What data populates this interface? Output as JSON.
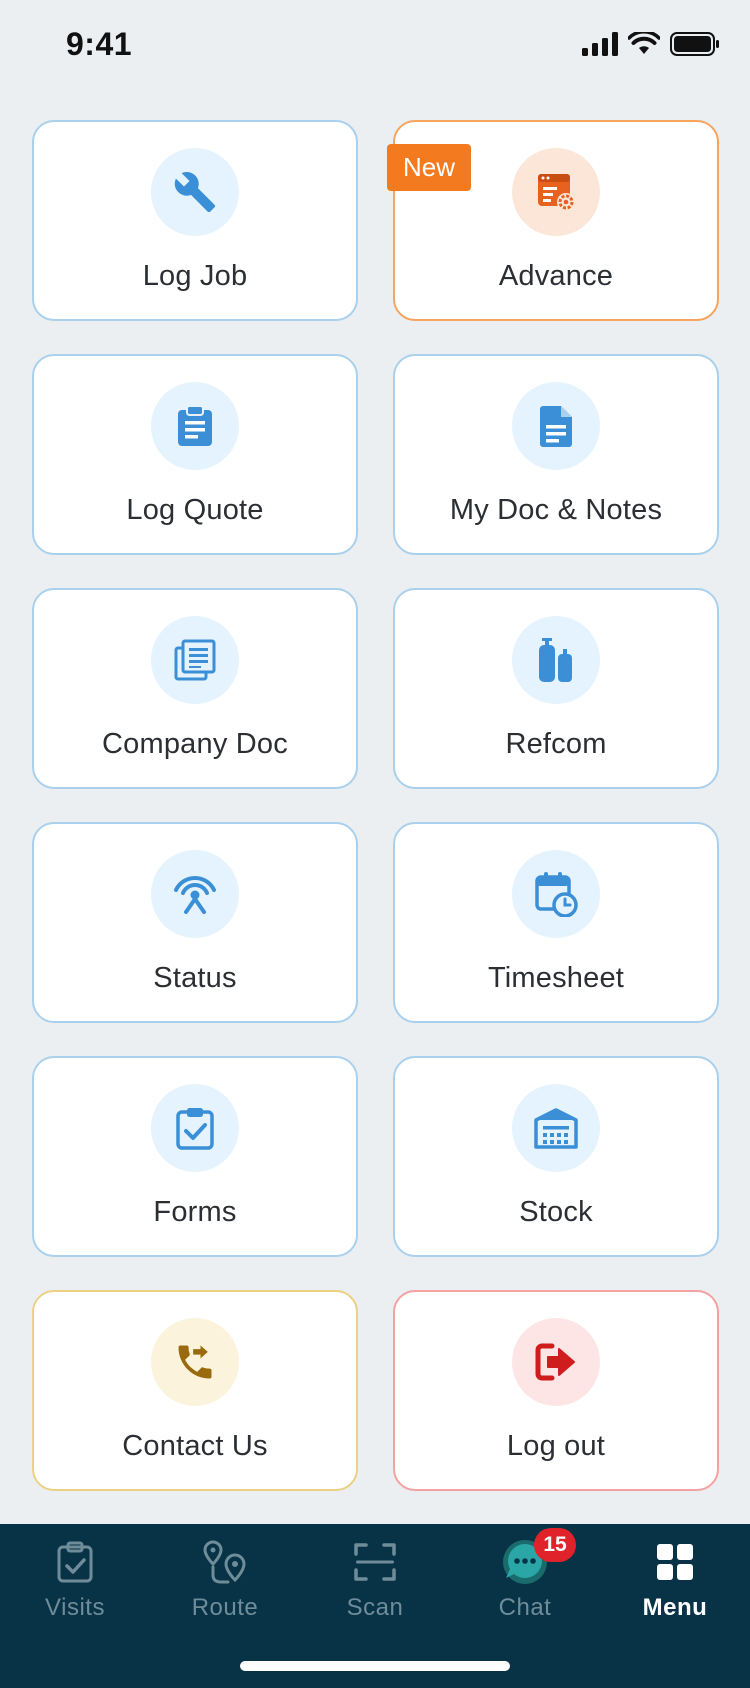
{
  "status_bar": {
    "time": "9:41"
  },
  "tiles": [
    {
      "label": "Log Job",
      "icon": "wrench-icon"
    },
    {
      "label": "Advance",
      "icon": "settings-window-icon",
      "badge": "New"
    },
    {
      "label": "Log Quote",
      "icon": "clipboard-icon"
    },
    {
      "label": "My Doc & Notes",
      "icon": "document-icon"
    },
    {
      "label": "Company Doc",
      "icon": "newspaper-icon"
    },
    {
      "label": "Refcom",
      "icon": "gas-cylinder-icon"
    },
    {
      "label": "Status",
      "icon": "broadcast-icon"
    },
    {
      "label": "Timesheet",
      "icon": "calendar-clock-icon"
    },
    {
      "label": "Forms",
      "icon": "clipboard-check-icon"
    },
    {
      "label": "Stock",
      "icon": "warehouse-icon"
    },
    {
      "label": "Contact Us",
      "icon": "phone-forward-icon"
    },
    {
      "label": "Log out",
      "icon": "logout-icon"
    }
  ],
  "tabbar": {
    "items": [
      {
        "label": "Visits",
        "icon": "clipboard-check-icon"
      },
      {
        "label": "Route",
        "icon": "map-route-icon"
      },
      {
        "label": "Scan",
        "icon": "scan-icon"
      },
      {
        "label": "Chat",
        "icon": "chat-icon",
        "badge": "15"
      },
      {
        "label": "Menu",
        "icon": "grid-icon",
        "active": true
      }
    ]
  },
  "colors": {
    "accent_blue": "#3b8fd6",
    "accent_orange": "#f37a1f",
    "tabbar_bg": "#083346",
    "badge_red": "#e0232b"
  }
}
